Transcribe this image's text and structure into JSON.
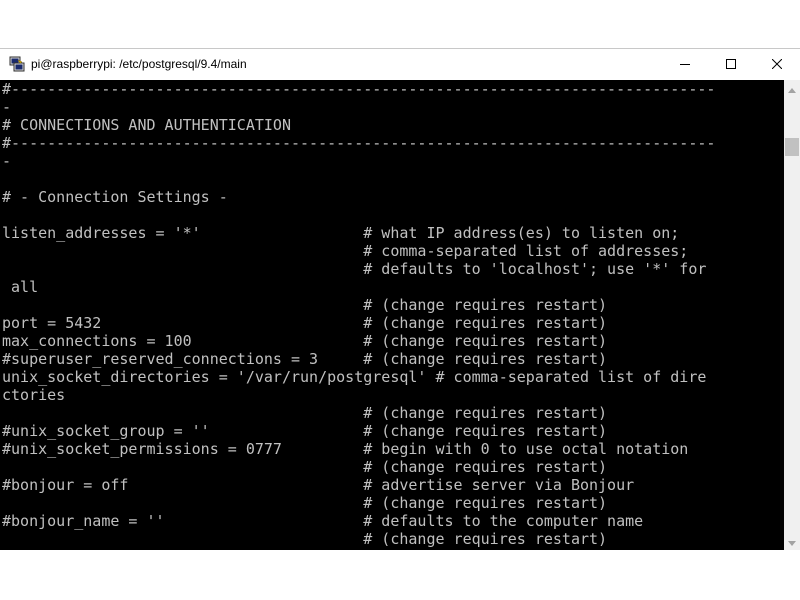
{
  "window": {
    "title": "pi@raspberrypi: /etc/postgresql/9.4/main",
    "app_icon": "putty-icon",
    "controls": {
      "minimize": "minimize-icon",
      "maximize": "maximize-icon",
      "close": "close-icon"
    }
  },
  "terminal": {
    "background": "#000000",
    "foreground": "#c0c0c0",
    "lines": [
      "#------------------------------------------------------------------------------",
      "-",
      "# CONNECTIONS AND AUTHENTICATION",
      "#------------------------------------------------------------------------------",
      "-",
      "",
      "# - Connection Settings -",
      "",
      "listen_addresses = '*'                  # what IP address(es) to listen on;",
      "                                        # comma-separated list of addresses;",
      "                                        # defaults to 'localhost'; use '*' for",
      " all",
      "                                        # (change requires restart)",
      "port = 5432                             # (change requires restart)",
      "max_connections = 100                   # (change requires restart)",
      "#superuser_reserved_connections = 3     # (change requires restart)",
      "unix_socket_directories = '/var/run/postgresql' # comma-separated list of dire",
      "ctories",
      "                                        # (change requires restart)",
      "#unix_socket_group = ''                 # (change requires restart)",
      "#unix_socket_permissions = 0777         # begin with 0 to use octal notation",
      "                                        # (change requires restart)",
      "#bonjour = off                          # advertise server via Bonjour",
      "                                        # (change requires restart)",
      "#bonjour_name = ''                      # defaults to the computer name",
      "                                        # (change requires restart)"
    ]
  },
  "scrollbar": {
    "up_icon": "scroll-up-arrow-icon",
    "down_icon": "scroll-down-arrow-icon"
  }
}
